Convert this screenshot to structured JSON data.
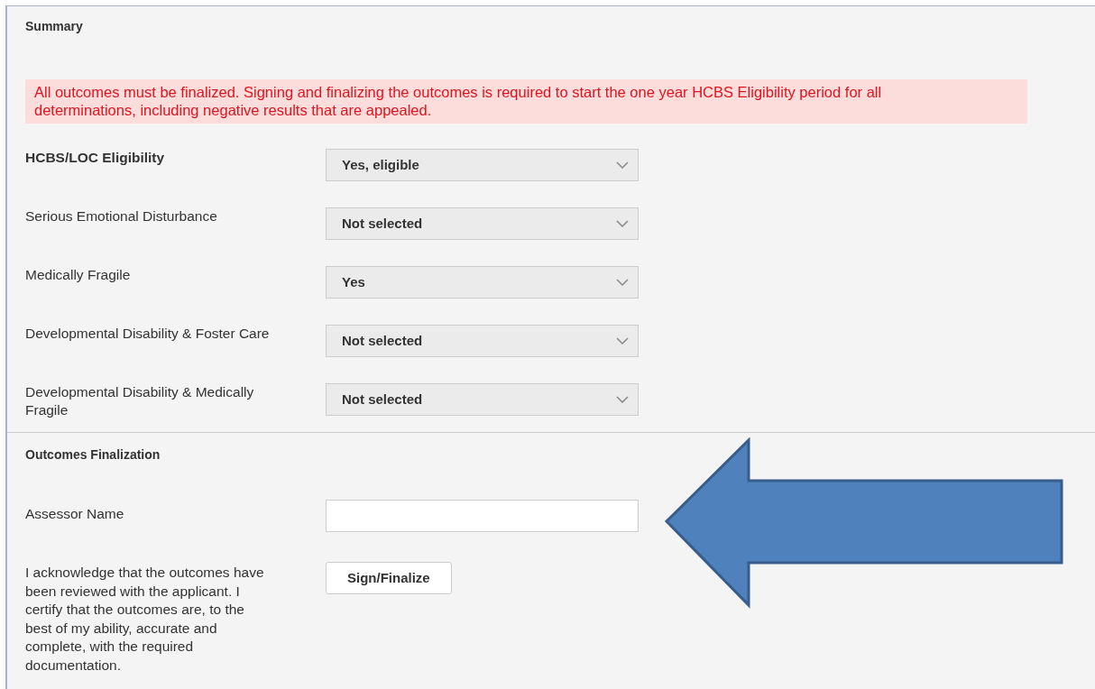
{
  "summary": {
    "title": "Summary",
    "alert": "All outcomes must be finalized. Signing and finalizing the outcomes is required to start the one year HCBS Eligibility period for all determinations, including negative results that are appealed.",
    "fields": [
      {
        "label": "HCBS/LOC Eligibility",
        "emphasis": true,
        "value": "Yes, eligible"
      },
      {
        "label": "Serious Emotional Disturbance",
        "emphasis": false,
        "value": "Not selected"
      },
      {
        "label": "Medically Fragile",
        "emphasis": false,
        "value": "Yes"
      },
      {
        "label": "Developmental Disability & Foster Care",
        "emphasis": false,
        "value": "Not selected"
      },
      {
        "label": "Developmental Disability & Medically Fragile",
        "emphasis": false,
        "value": "Not selected"
      }
    ]
  },
  "finalization": {
    "title": "Outcomes Finalization",
    "assessor_label": "Assessor Name",
    "acknowledgement": "I acknowledge that the outcomes have been reviewed with the applicant. I certify that the outcomes are, to the best of my ability, accurate and complete, with the required documentation.",
    "button": "Sign/Finalize"
  }
}
